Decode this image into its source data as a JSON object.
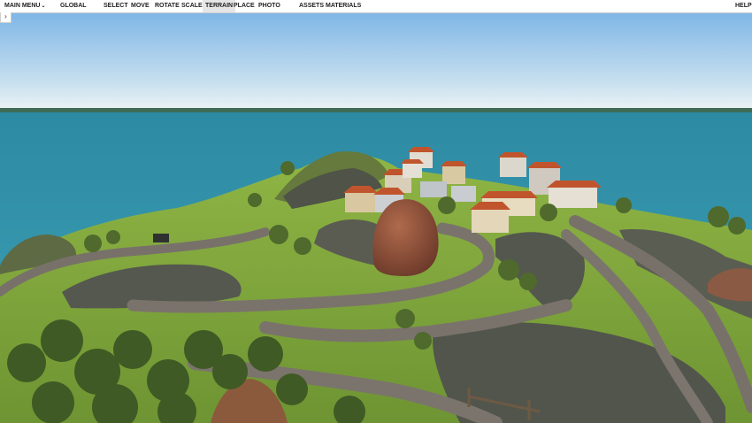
{
  "toolbar": {
    "main_menu": "MAIN MENU",
    "global": "GLOBAL",
    "select": "SELECT",
    "move": "MOVE",
    "rotate": "ROTATE",
    "scale": "SCALE",
    "terrain": "TERRAIN",
    "place": "PLACE",
    "photo": "PHOTO",
    "assets": "ASSETS",
    "materials": "MATERIALS",
    "help": "HELP",
    "active_tool": "TERRAIN"
  },
  "sidebar_toggle": {
    "icon": "chevron-right-icon",
    "glyph": "›"
  },
  "scene": {
    "sky_top": "#8fc3ee",
    "sky_horizon": "#e8f1f6",
    "sea": "#3a9bb0",
    "grass": "#7fa83a",
    "rock": "#5b5e52",
    "path": "#777067",
    "roof": "#c0552d",
    "boulder": "#8a4a35"
  }
}
